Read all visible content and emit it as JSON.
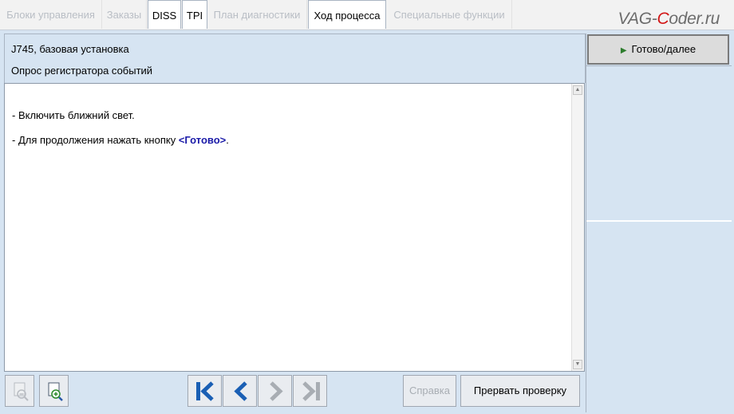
{
  "tabs": [
    {
      "label": "Блоки управления",
      "active": false
    },
    {
      "label": "Заказы",
      "active": false
    },
    {
      "label": "DISS",
      "active": true
    },
    {
      "label": "TPI",
      "active": true
    },
    {
      "label": "План диагностики",
      "active": false
    },
    {
      "label": "Ход процесса",
      "active": true
    },
    {
      "label": "Специальные функции",
      "active": false
    }
  ],
  "watermark": {
    "prefix": "VAG-",
    "highlight": "C",
    "suffix": "oder.ru"
  },
  "header": {
    "title": "J745, базовая установка",
    "subtitle": "Опрос регистратора событий"
  },
  "content": {
    "line1": "- Включить ближний свет.",
    "line2_prefix": "- Для продолжения нажать кнопку ",
    "line2_button": "<Готово>",
    "line2_suffix": "."
  },
  "right_panel": {
    "next_button": "Готово/далее"
  },
  "toolbar": {
    "help_label": "Справка",
    "abort_label": "Прервать проверку"
  },
  "colors": {
    "accent_blue": "#1a5fb4",
    "play_green": "#2e7d2e",
    "panel_bg": "#d6e4f2"
  }
}
